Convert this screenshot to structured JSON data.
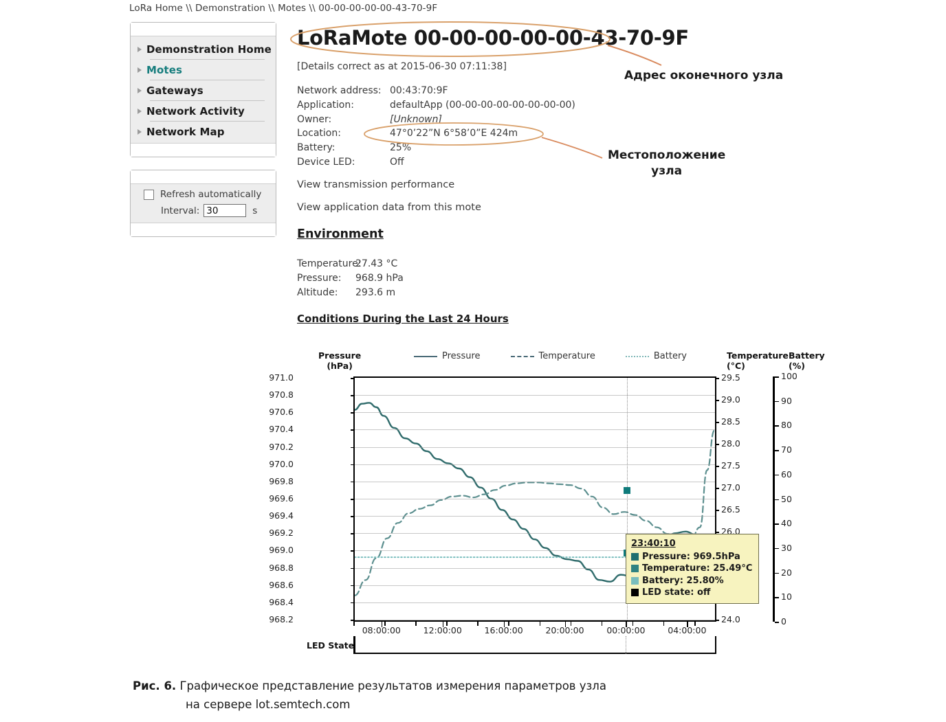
{
  "breadcrumb": "LoRa Home \\\\ Demonstration \\\\ Motes \\\\ 00-00-00-00-00-43-70-9F",
  "sidebar": {
    "items": [
      {
        "label": "Demonstration Home",
        "active": false
      },
      {
        "label": "Motes",
        "active": true
      },
      {
        "label": "Gateways",
        "active": false
      },
      {
        "label": "Network Activity",
        "active": false
      },
      {
        "label": "Network Map",
        "active": false
      }
    ],
    "refresh": {
      "checkbox_label": "Refresh automatically",
      "checked": false,
      "interval_label": "Interval:",
      "interval_value": "30",
      "interval_unit": "s"
    }
  },
  "main": {
    "title": "LoRaMote 00-00-00-00-00-43-70-9F",
    "details_timestamp": "[Details correct as at 2015-06-30 07:11:38]",
    "details": [
      {
        "key": "Network address:",
        "value": "00:43:70:9F"
      },
      {
        "key": "Application:",
        "value": "defaultApp (00-00-00-00-00-00-00-00)"
      },
      {
        "key": "Owner:",
        "value": "[Unknown]"
      },
      {
        "key": "Location:",
        "value": "47°0’22”N 6°58’0”E 424m"
      },
      {
        "key": "Battery:",
        "value": "25%"
      },
      {
        "key": "Device LED:",
        "value": "Off"
      }
    ],
    "links": [
      "View transmission performance",
      "View application data from this mote"
    ],
    "environment_heading": "Environment",
    "environment": [
      {
        "key": "Temperature:",
        "value": "27.43 °C"
      },
      {
        "key": "Pressure:",
        "value": "968.9 hPa"
      },
      {
        "key": "Altitude:",
        "value": "293.6 m"
      }
    ],
    "conditions_heading": "Conditions During the Last 24 Hours"
  },
  "annotations": [
    {
      "text": "Адрес оконечного узла"
    },
    {
      "text_line1": "Местоположение",
      "text_line2": "узла"
    }
  ],
  "caption": {
    "prefix": "Рис. 6.",
    "line1": " Графическое представление результатов измерения параметров узла",
    "line2": "на сервере lot.semtech.com"
  },
  "colors": {
    "pressure": "#2f6b6b",
    "temperature": "#5c8f8f",
    "battery": "#79bdbd",
    "led": "#000000",
    "accent_nav": "#167d7d",
    "annotation": "#d98b5f",
    "tooltip_bg": "#f7f3bf"
  },
  "chart_data": {
    "type": "line",
    "title": "Conditions During the Last 24 Hours",
    "xlabel": "",
    "grid": true,
    "legend_position": "top",
    "legend": [
      "Pressure",
      "Temperature",
      "Battery"
    ],
    "axes": {
      "left": {
        "label": "Pressure",
        "unit": "(hPa)",
        "ylim": [
          968.2,
          971.0
        ],
        "ticks": [
          971.0,
          970.8,
          970.6,
          970.4,
          970.2,
          970.0,
          969.8,
          969.6,
          969.4,
          969.2,
          969.0,
          968.8,
          968.6,
          968.4,
          968.2
        ]
      },
      "right_temperature": {
        "label": "Temperature",
        "unit": "(°C)",
        "ylim": [
          24.0,
          29.5
        ],
        "ticks": [
          29.5,
          29.0,
          28.5,
          28.0,
          27.5,
          27.0,
          26.5,
          26.0,
          25.5,
          25.0,
          24.5,
          24.0
        ]
      },
      "right_battery": {
        "label": "Battery",
        "unit": "(%)",
        "ylim": [
          0,
          100
        ],
        "ticks": [
          100,
          90,
          80,
          70,
          60,
          50,
          40,
          30,
          20,
          10,
          0
        ]
      }
    },
    "x_ticks": [
      "08:00:00",
      "12:00:00",
      "16:00:00",
      "20:00:00",
      "00:00:00",
      "04:00:00"
    ],
    "x_tick_fractions": [
      0.078,
      0.248,
      0.418,
      0.588,
      0.758,
      0.928
    ],
    "series": [
      {
        "name": "Pressure",
        "unit": "hPa",
        "style": "solid",
        "axis": "left",
        "x": [
          0.0,
          0.02,
          0.04,
          0.06,
          0.08,
          0.11,
          0.14,
          0.17,
          0.2,
          0.23,
          0.26,
          0.29,
          0.32,
          0.35,
          0.38,
          0.41,
          0.44,
          0.47,
          0.5,
          0.53,
          0.56,
          0.59,
          0.62,
          0.65,
          0.68,
          0.71,
          0.74,
          0.77,
          0.8,
          0.83,
          0.86,
          0.89,
          0.92,
          0.95,
          0.98,
          1.0
        ],
        "values": [
          970.63,
          970.7,
          970.71,
          970.66,
          970.56,
          970.42,
          970.3,
          970.24,
          970.15,
          970.06,
          970.01,
          969.95,
          969.85,
          969.73,
          969.6,
          969.47,
          969.36,
          969.25,
          969.13,
          969.03,
          968.94,
          968.9,
          968.88,
          968.78,
          968.66,
          968.64,
          968.72,
          968.7,
          968.78,
          968.94,
          969.1,
          969.2,
          969.22,
          969.18,
          969.1,
          969.05
        ]
      },
      {
        "name": "Temperature",
        "unit": "°C",
        "style": "dashed",
        "axis": "right_temperature",
        "x": [
          0.0,
          0.03,
          0.06,
          0.09,
          0.12,
          0.15,
          0.18,
          0.21,
          0.24,
          0.27,
          0.3,
          0.33,
          0.36,
          0.39,
          0.42,
          0.45,
          0.48,
          0.51,
          0.54,
          0.57,
          0.6,
          0.63,
          0.66,
          0.69,
          0.72,
          0.75,
          0.78,
          0.81,
          0.84,
          0.87,
          0.9,
          0.93,
          0.96,
          0.98,
          1.0
        ],
        "values": [
          24.55,
          24.9,
          25.4,
          25.85,
          26.2,
          26.42,
          26.52,
          26.6,
          26.72,
          26.8,
          26.82,
          26.78,
          26.85,
          26.95,
          27.05,
          27.1,
          27.12,
          27.12,
          27.1,
          27.08,
          27.06,
          26.98,
          26.8,
          26.55,
          26.4,
          26.45,
          26.38,
          26.25,
          26.1,
          25.95,
          25.85,
          25.7,
          26.1,
          27.4,
          28.3
        ]
      },
      {
        "name": "Battery",
        "unit": "%",
        "style": "dotted",
        "axis": "right_battery",
        "x": [
          0.0,
          1.0
        ],
        "values": [
          25.8,
          25.8
        ]
      }
    ],
    "led_state": {
      "label": "LED State",
      "value": "off"
    },
    "cursor": {
      "x_fraction": 0.758,
      "tooltip": {
        "time": "23:40:10",
        "rows": [
          {
            "label": "Pressure: 969.5hPa",
            "color": "#1f6f6f"
          },
          {
            "label": "Temperature: 25.49°C",
            "color": "#2f8282"
          },
          {
            "label": "Battery: 25.80%",
            "color": "#79bdbd"
          },
          {
            "label": "LED state: off",
            "color": "#000000"
          }
        ]
      },
      "markers": [
        {
          "series": "Pressure",
          "y_fraction": 0.466
        },
        {
          "series": "Temperature",
          "y_fraction": 0.725
        }
      ]
    }
  }
}
